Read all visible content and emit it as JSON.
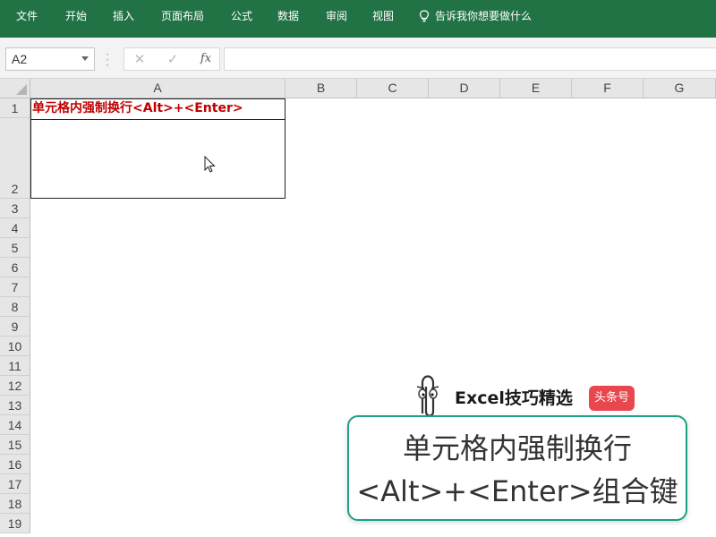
{
  "ribbon": {
    "tabs": [
      "文件",
      "开始",
      "插入",
      "页面布局",
      "公式",
      "数据",
      "审阅",
      "视图"
    ],
    "tell_me": "告诉我你想要做什么"
  },
  "formula_bar": {
    "name_box": "A2",
    "cancel_symbol": "✕",
    "enter_symbol": "✓",
    "fx_label": "fx",
    "content": ""
  },
  "sheet": {
    "columns": [
      "A",
      "B",
      "C",
      "D",
      "E",
      "F",
      "G"
    ],
    "rows": [
      "1",
      "2",
      "3",
      "4",
      "5",
      "6",
      "7",
      "8",
      "9",
      "10",
      "11",
      "12",
      "13",
      "14",
      "15",
      "16",
      "17",
      "18",
      "19"
    ],
    "cell_a1": "单元格内强制换行<Alt>+<Enter>"
  },
  "watermark": {
    "title": "Excel技巧精选",
    "badge": "头条号"
  },
  "caption": {
    "line1": "单元格内强制换行",
    "line2": "<Alt>+<Enter>组合键"
  },
  "colors": {
    "ribbon_green": "#217346",
    "a1_text": "#c00000",
    "caption_border": "#1aa283",
    "badge_red": "#e8484d"
  }
}
